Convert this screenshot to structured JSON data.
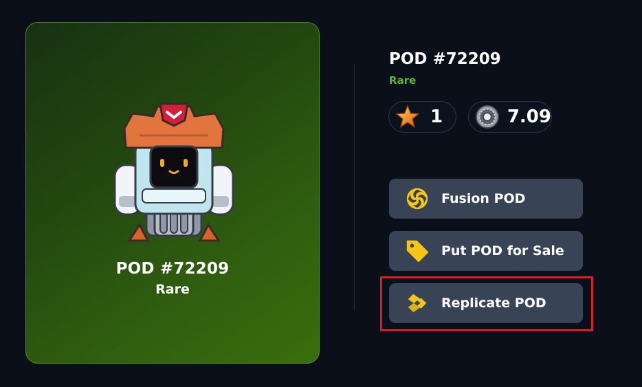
{
  "card": {
    "title": "POD #72209",
    "rarity": "Rare",
    "image_icon": "robot-pod-icon"
  },
  "details": {
    "title": "POD #72209",
    "rarity": "Rare",
    "rarity_color": "#5fb533",
    "stats": [
      {
        "icon": "star-icon",
        "value": "1"
      },
      {
        "icon": "gear-coin-icon",
        "value": "7.09"
      }
    ]
  },
  "actions": [
    {
      "icon": "fusion-swirl-icon",
      "label": "Fusion POD"
    },
    {
      "icon": "price-tag-icon",
      "label": "Put POD for Sale"
    },
    {
      "icon": "replicate-icon",
      "label": "Replicate POD"
    }
  ],
  "colors": {
    "background": "#0a0f19",
    "button": "#384456",
    "highlight": "#dc1f26",
    "accent_yellow": "#f5c518"
  }
}
